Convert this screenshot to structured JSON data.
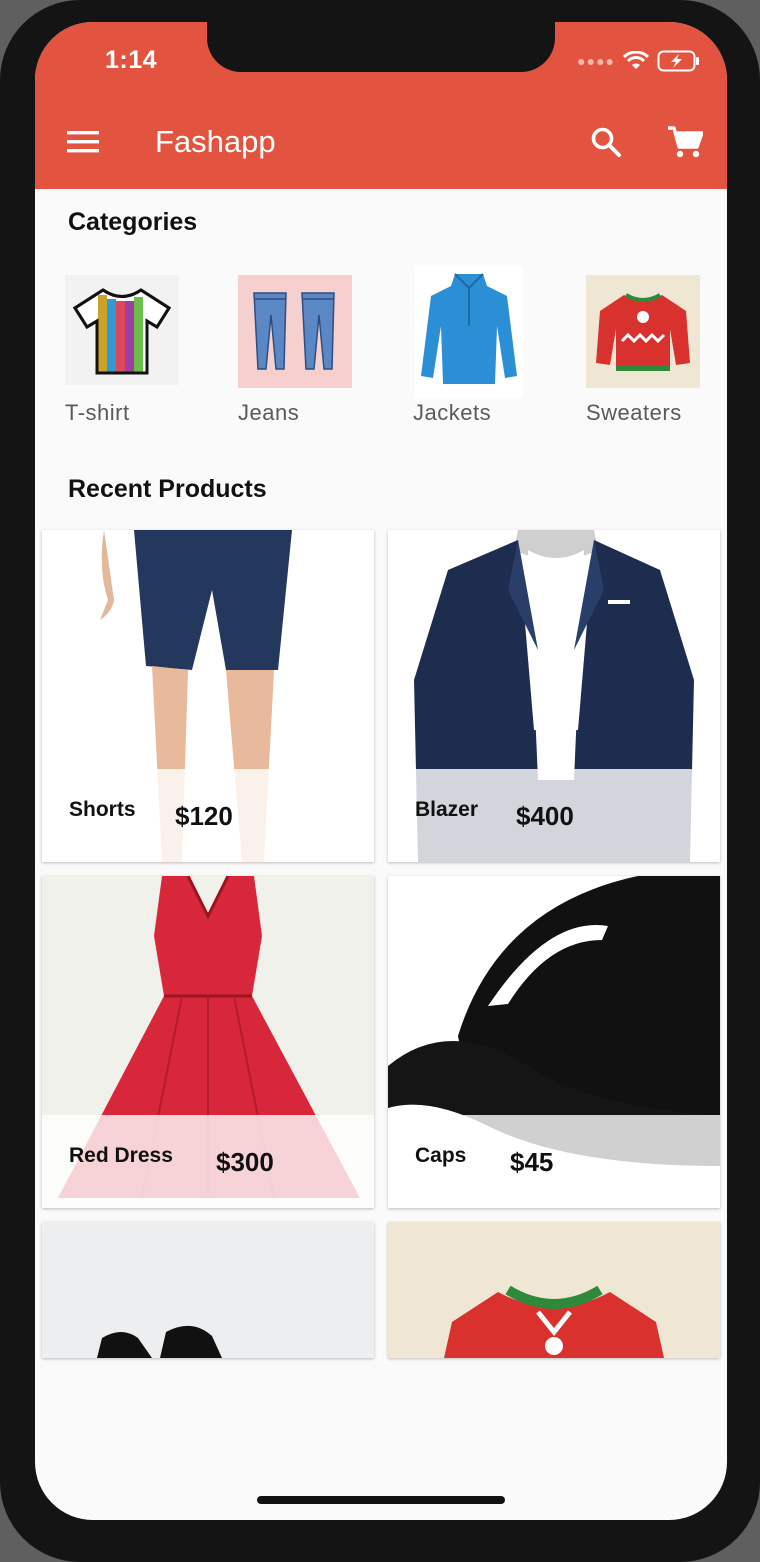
{
  "status_bar": {
    "time": "1:14"
  },
  "app_bar": {
    "title": "Fashapp",
    "menu_icon": "hamburger-menu-icon",
    "search_icon": "search-icon",
    "cart_icon": "shopping-cart-icon",
    "color": "#e35440"
  },
  "categories": {
    "heading": "Categories",
    "items": [
      {
        "label": "T-shirt"
      },
      {
        "label": "Jeans"
      },
      {
        "label": "Jackets"
      },
      {
        "label": "Sweaters"
      }
    ]
  },
  "recent_products": {
    "heading": "Recent Products",
    "items": [
      {
        "name": "Shorts",
        "price": "$120"
      },
      {
        "name": "Blazer",
        "price": "$400"
      },
      {
        "name": "Red Dress",
        "price": "$300"
      },
      {
        "name": "Caps",
        "price": "$45"
      }
    ]
  }
}
